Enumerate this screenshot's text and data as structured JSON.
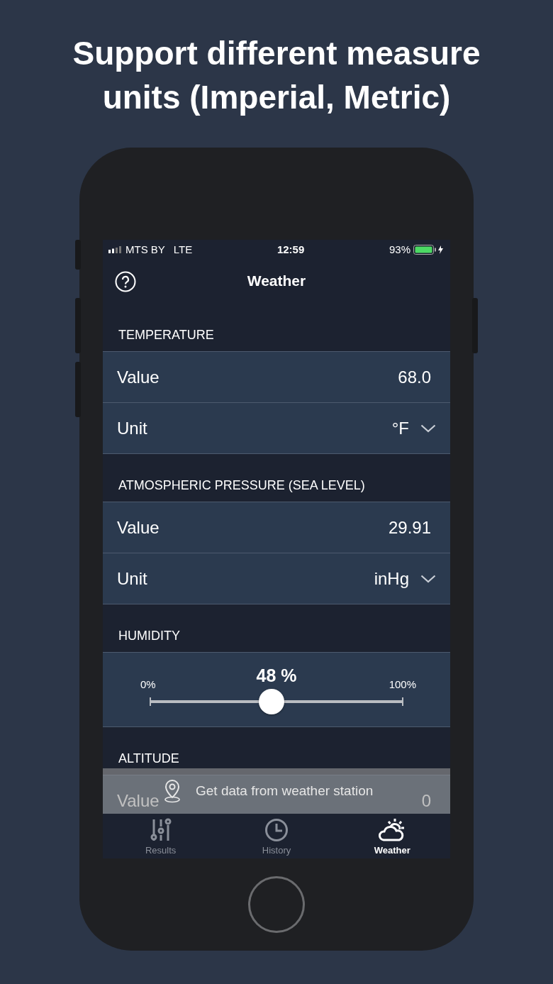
{
  "headline": "Support different measure units (Imperial, Metric)",
  "status_bar": {
    "carrier": "MTS BY",
    "network": "LTE",
    "time": "12:59",
    "battery": "93%"
  },
  "nav": {
    "title": "Weather"
  },
  "sections": [
    {
      "title": "TEMPERATURE",
      "kind": "rows",
      "rows": [
        {
          "label": "Value",
          "value": "68.0",
          "kind": "text"
        },
        {
          "label": "Unit",
          "value": "°F",
          "kind": "dropdown"
        }
      ]
    },
    {
      "title": "ATMOSPHERIC PRESSURE (SEA LEVEL)",
      "kind": "rows",
      "rows": [
        {
          "label": "Value",
          "value": "29.91",
          "kind": "text"
        },
        {
          "label": "Unit",
          "value": "inHg",
          "kind": "dropdown"
        }
      ]
    },
    {
      "title": "HUMIDITY",
      "kind": "slider",
      "reading": "48 %",
      "min_label": "0%",
      "max_label": "100%",
      "level": 0.48
    },
    {
      "title": "ALTITUDE",
      "kind": "rows",
      "rows": [
        {
          "label": "Value",
          "value": "0",
          "kind": "text"
        }
      ]
    }
  ],
  "banner": {
    "text": "Get data from weather station"
  },
  "tabs": [
    {
      "label": "Results",
      "kind": "sliders",
      "selected": false
    },
    {
      "label": "History",
      "kind": "clock",
      "selected": false
    },
    {
      "label": "Weather",
      "kind": "weather",
      "selected": true
    }
  ]
}
